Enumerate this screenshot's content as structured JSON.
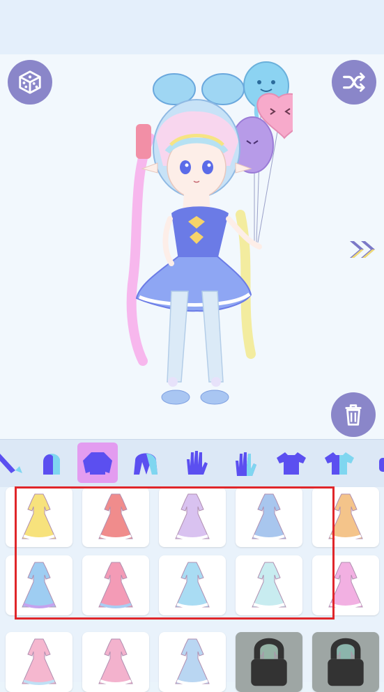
{
  "colors": {
    "accent": "#8a86c9",
    "tab_active": "#e39cf0",
    "tab_icon": "#5b4ff0",
    "highlight_box": "#e0262a"
  },
  "stage": {
    "buttons": [
      {
        "name": "random-dice-button",
        "icon": "dice-icon"
      },
      {
        "name": "shuffle-button",
        "icon": "shuffle-icon"
      },
      {
        "name": "next-page-button",
        "icon": "double-chevron-right-icon"
      },
      {
        "name": "delete-button",
        "icon": "trash-icon"
      }
    ]
  },
  "category_tabs": [
    {
      "name": "tab-accessory",
      "icon": "partial-icon",
      "active": false
    },
    {
      "name": "tab-hair-back",
      "icon": "hair-back-icon",
      "active": false
    },
    {
      "name": "tab-top",
      "icon": "sweater-icon",
      "active": true
    },
    {
      "name": "tab-hair-front",
      "icon": "hair-front-icon",
      "active": false
    },
    {
      "name": "tab-gloves",
      "icon": "glove-icon",
      "active": false
    },
    {
      "name": "tab-glove-alt",
      "icon": "glove-alt-icon",
      "active": false
    },
    {
      "name": "tab-tshirt",
      "icon": "tshirt-icon",
      "active": false
    },
    {
      "name": "tab-shirt-alt",
      "icon": "shirt-alt-icon",
      "active": false
    },
    {
      "name": "tab-more",
      "icon": "partial-icon",
      "active": false
    }
  ],
  "outfits": [
    {
      "name": "yellow-maid-dress",
      "color": "#f7e27c",
      "trim": "#ffffff",
      "locked": false
    },
    {
      "name": "red-plaid-dress",
      "color": "#f08c8c",
      "trim": "#ffffff",
      "locked": false
    },
    {
      "name": "lavender-floral-gown",
      "color": "#d9c2f0",
      "trim": "#ffffff",
      "locked": false
    },
    {
      "name": "blue-white-gown",
      "color": "#a8c6ee",
      "trim": "#ffffff",
      "locked": false
    },
    {
      "name": "orange-check-dress",
      "color": "#f4c48a",
      "trim": "#ffffff",
      "locked": false
    },
    {
      "name": "purple-blue-dress",
      "color": "#9ecdf2",
      "trim": "#c4a2ee",
      "locked": false
    },
    {
      "name": "pink-blue-dress",
      "color": "#f39bb6",
      "trim": "#a9cdf3",
      "locked": false
    },
    {
      "name": "sky-blue-dress",
      "color": "#a9dcf3",
      "trim": "#ffffff",
      "locked": false
    },
    {
      "name": "white-aqua-gown",
      "color": "#c8ecf0",
      "trim": "#ffffff",
      "locked": false
    },
    {
      "name": "pink-purple-gown",
      "color": "#f2b0e2",
      "trim": "#ffffff",
      "locked": false
    },
    {
      "name": "pink-lace-dress",
      "color": "#f5b7cf",
      "trim": "#bfe0f5",
      "locked": false
    },
    {
      "name": "pink-bow-dress",
      "color": "#f3b2cd",
      "trim": "#ffffff",
      "locked": false
    },
    {
      "name": "blue-gown",
      "color": "#b9d6f2",
      "trim": "#ffffff",
      "locked": false
    },
    {
      "name": "green-gown",
      "color": "#8fc0a8",
      "trim": "#a9b3b0",
      "locked": true
    },
    {
      "name": "teal-gown",
      "color": "#7cc3b4",
      "trim": "#a9b3b0",
      "locked": true
    }
  ]
}
